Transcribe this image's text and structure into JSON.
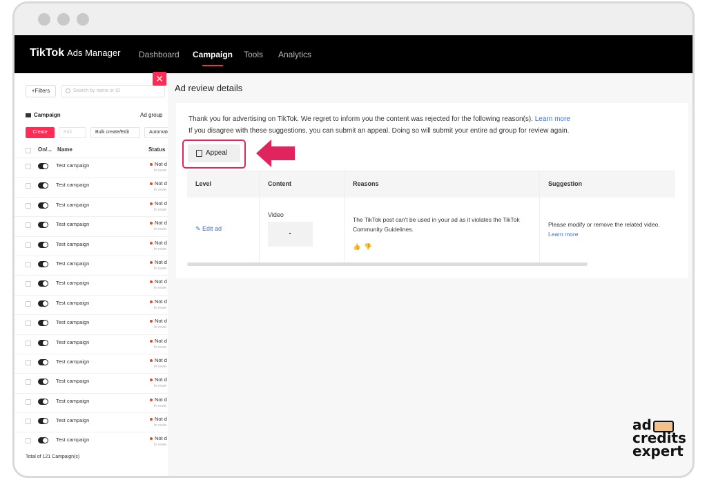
{
  "app": {
    "logo": "TikTok",
    "logo_sub": "Ads Manager"
  },
  "nav": [
    {
      "label": "Dashboard"
    },
    {
      "label": "Campaign"
    },
    {
      "label": "Tools"
    },
    {
      "label": "Analytics"
    }
  ],
  "left": {
    "filters": "+Filters",
    "search_placeholder": "Search by name or ID",
    "campaign_tab": "Campaign",
    "ad_group_tab": "Ad group",
    "create": "Create",
    "edit": "Edit",
    "bulk": "Bulk create/Edit",
    "automate": "Automate",
    "col_onoff": "On/...",
    "col_name": "Name",
    "col_status": "Status",
    "rows": [
      {
        "name": "Test campaign",
        "status": "Not d",
        "sub": "In revie"
      },
      {
        "name": "Test campaign",
        "status": "Not d",
        "sub": "In revie"
      },
      {
        "name": "Test campaign",
        "status": "Not d",
        "sub": "In revie"
      },
      {
        "name": "Test campaign",
        "status": "Not d",
        "sub": "In revie"
      },
      {
        "name": "Test campaign",
        "status": "Not d",
        "sub": "In revie"
      },
      {
        "name": "Test campaign",
        "status": "Not d",
        "sub": "In revie"
      },
      {
        "name": "Test campaign",
        "status": "Not d",
        "sub": "In revie"
      },
      {
        "name": "Test campaign",
        "status": "Not d",
        "sub": "In revie"
      },
      {
        "name": "Test campaign",
        "status": "Not d",
        "sub": "In revie"
      },
      {
        "name": "Test campaign",
        "status": "Not d",
        "sub": "In revie"
      },
      {
        "name": "Test campaign",
        "status": "Not d",
        "sub": "In revie"
      },
      {
        "name": "Test campaign",
        "status": "Not d",
        "sub": "In revie"
      },
      {
        "name": "Test campaign",
        "status": "Not d",
        "sub": "In revie"
      },
      {
        "name": "Test campaign",
        "status": "Not d",
        "sub": "In revie"
      },
      {
        "name": "Test campaign",
        "status": "Not d",
        "sub": "In revie"
      }
    ],
    "total": "Total of 121 Campaign(s)"
  },
  "drawer": {
    "close": "✕",
    "title": "Ad review details",
    "msg1": "Thank you for advertising on TikTok. We regret to inform you the content was rejected for the following reason(s).",
    "msg1_link": "Learn more",
    "msg2": "If you disagree with these suggestions, you can submit an appeal. Doing so will submit your entire ad group for review again.",
    "appeal": "Appeal",
    "headers": {
      "level": "Level",
      "content": "Content",
      "reasons": "Reasons",
      "suggestion": "Suggestion"
    },
    "edit_ad": "Edit ad",
    "content_type": "Video",
    "reason": "The TikTok post can't be used in your ad as it violates the TikTok Community Guidelines.",
    "suggestion": "Please modify or remove the related video.",
    "suggestion_link": "Learn more"
  },
  "brand": {
    "line1": "ad",
    "line2": "credits",
    "line3": "expert"
  },
  "colors": {
    "accent": "#fe2c55",
    "link": "#3b6fdb",
    "highlight": "#e0245e"
  }
}
